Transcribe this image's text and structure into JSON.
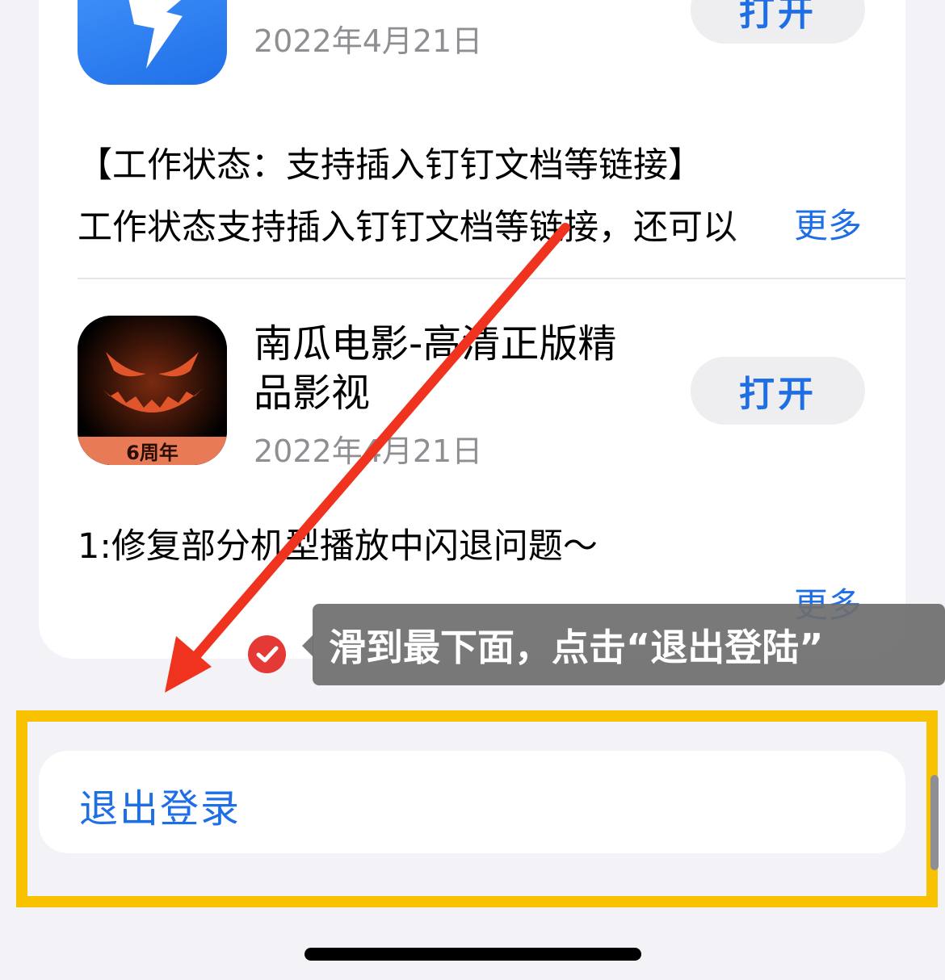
{
  "apps": [
    {
      "name": "",
      "date": "2022年4月21日",
      "open_label": "打开",
      "icon": "dingtalk-icon",
      "desc_title": "【工作状态：支持插入钉钉文档等链接】",
      "desc_body": "工作状态支持插入钉钉文档等链接，还可以",
      "more_label": "更多"
    },
    {
      "name_line1": "南瓜电影-高清正版精",
      "name_line2": "品影视",
      "date": "2022年4月21日",
      "open_label": "打开",
      "icon": "pumpkin-movie-icon",
      "badge": "6周年",
      "desc_body": "1:修复部分机型播放中闪退问题～",
      "more_label": "更多"
    }
  ],
  "logout": {
    "label": "退出登录"
  },
  "annotation": {
    "tooltip": "滑到最下面，点击“退出登陆”",
    "arrow_color": "#f0331f",
    "highlight_color": "#f9c200"
  },
  "colors": {
    "accent": "#1e6ee6",
    "background": "#f2f2f7"
  }
}
